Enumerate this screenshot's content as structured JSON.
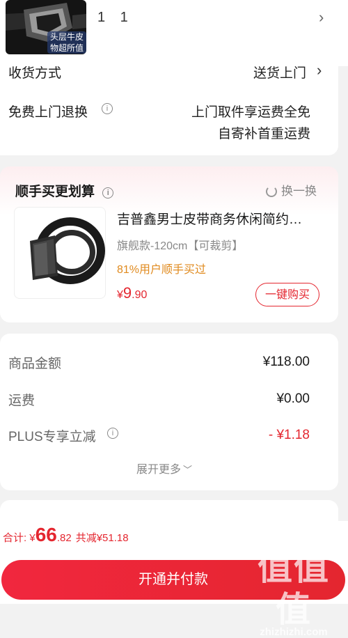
{
  "product": {
    "thumb_badge": "头层牛皮\n物超所值",
    "quantity": "1 1"
  },
  "shipping": {
    "method_label": "收货方式",
    "method_value": "送货上门",
    "return_label": "免费上门退换",
    "return_line1": "上门取件享运费全免",
    "return_line2": "自寄补首重运费"
  },
  "recommend": {
    "title": "顺手买更划算",
    "swap_label": "换一换",
    "item_name": "吉普鑫男士皮带商务休闲简约…",
    "item_spec": "旗舰款-120cm【可裁剪】",
    "item_stat": "81%用户顺手买过",
    "price_currency": "¥",
    "price_int": "9",
    "price_dec": ".90",
    "buy_label": "一键购买"
  },
  "summary": {
    "goods_label": "商品金额",
    "goods_value": "¥118.00",
    "freight_label": "运费",
    "freight_value": "¥0.00",
    "plus_label": "PLUS专享立减",
    "plus_value": "- ¥1.18",
    "expand_label": "展开更多"
  },
  "footer": {
    "total_label": "合计: ",
    "total_currency": "¥",
    "total_int": "66",
    "total_dec": ".82",
    "saved": "共减¥51.18",
    "pay_label": "开通并付款"
  },
  "watermark": {
    "big": "值值值",
    "url": "zhizhizhi.com"
  },
  "colors": {
    "accent_red": "#e4262f",
    "stat_orange": "#e08a1e"
  }
}
